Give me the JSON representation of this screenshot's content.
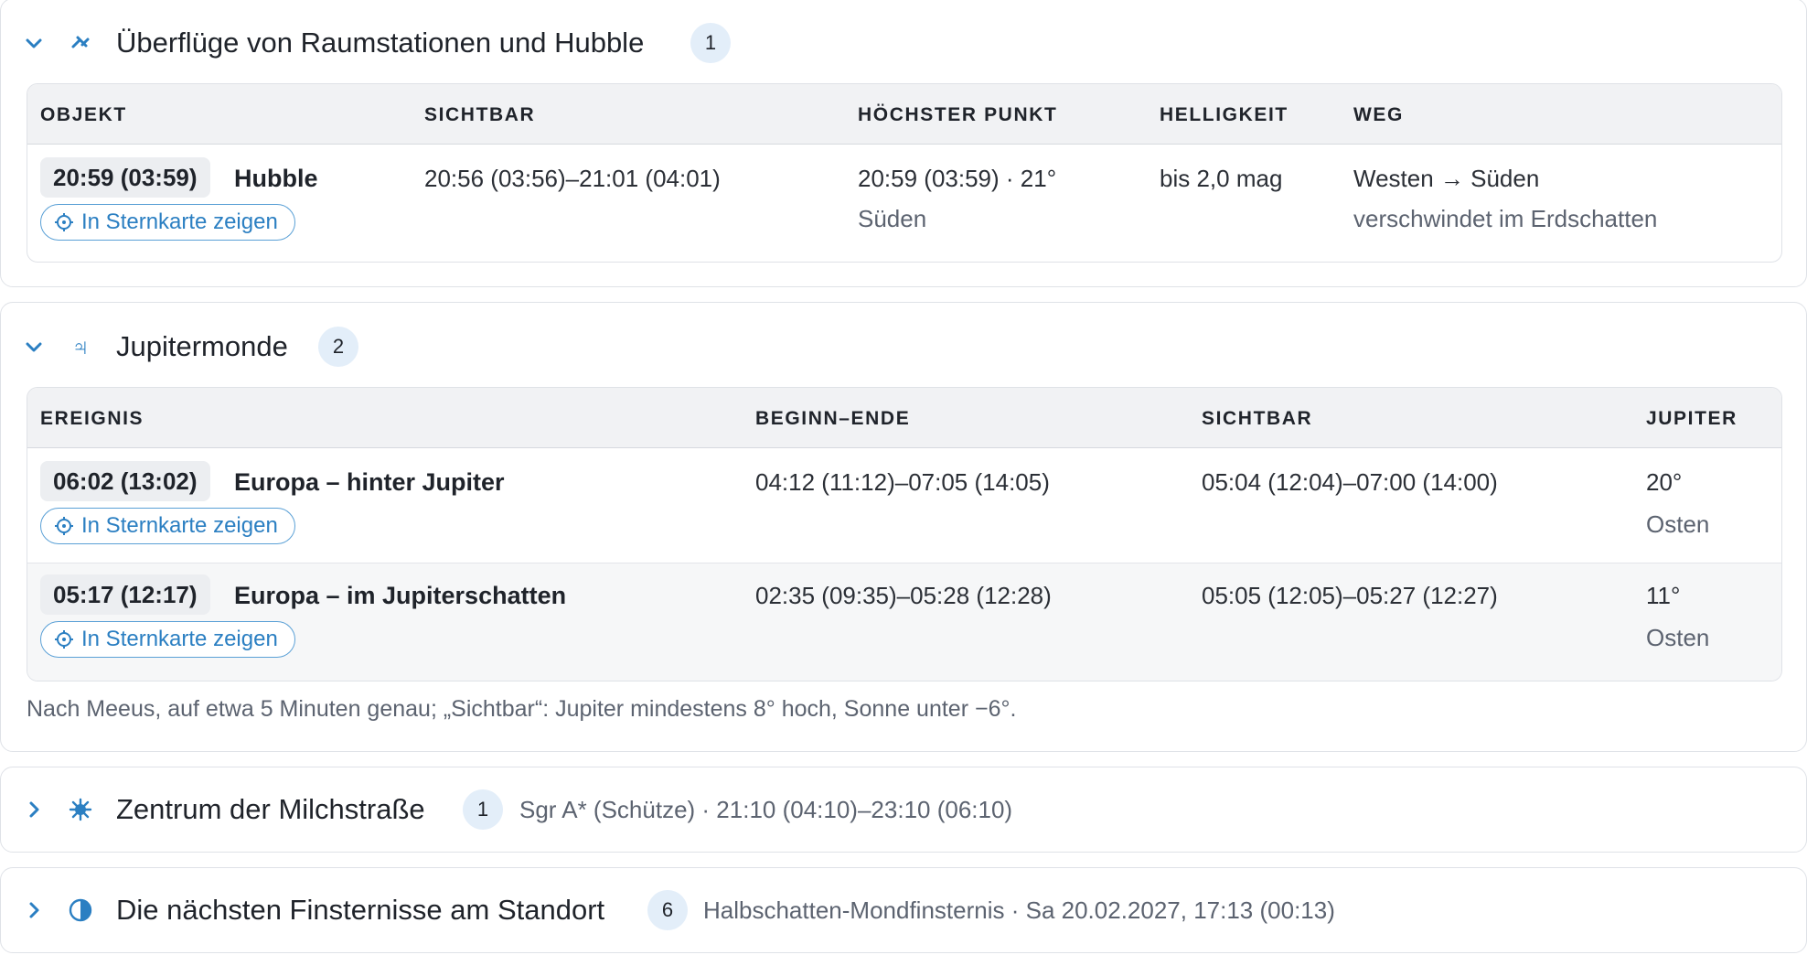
{
  "iss": {
    "title": "Überflüge von Raumstationen und Hubble",
    "count": "1",
    "columns": [
      "OBJEKT",
      "SICHTBAR",
      "HÖCHSTER PUNKT",
      "HELLIGKEIT",
      "WEG"
    ],
    "rows": [
      {
        "time": "20:59 (03:59)",
        "name": "Hubble",
        "map_label": "In Sternkarte zeigen",
        "visible": "20:56 (03:56)–21:01 (04:01)",
        "peak": "20:59 (03:59) · 21°",
        "peak_dir": "Süden",
        "brightness": "bis 2,0 mag",
        "path": "Westen → Süden",
        "path_note": "verschwindet im Erdschatten"
      }
    ]
  },
  "jupiter": {
    "title": "Jupitermonde",
    "count": "2",
    "columns": [
      "EREIGNIS",
      "BEGINN–ENDE",
      "SICHTBAR",
      "JUPITER"
    ],
    "rows": [
      {
        "time": "06:02 (13:02)",
        "name": "Europa – hinter Jupiter",
        "map_label": "In Sternkarte zeigen",
        "range": "04:12 (11:12)–07:05 (14:05)",
        "visible": "05:04 (12:04)–07:00 (14:00)",
        "alt": "20°",
        "dir": "Osten"
      },
      {
        "time": "05:17 (12:17)",
        "name": "Europa – im Jupiterschatten",
        "map_label": "In Sternkarte zeigen",
        "range": "02:35 (09:35)–05:28 (12:28)",
        "visible": "05:05 (12:05)–05:27 (12:27)",
        "alt": "11°",
        "dir": "Osten"
      }
    ],
    "note": "Nach Meeus, auf etwa 5 Minuten genau; „Sichtbar“: Jupiter mindestens 8° hoch, Sonne unter −6°."
  },
  "milkyway": {
    "title": "Zentrum der Milchstraße",
    "count": "1",
    "summary": "Sgr A* (Schütze) · 21:10 (04:10)–23:10 (06:10)"
  },
  "eclipses": {
    "title": "Die nächsten Finsternisse am Standort",
    "count": "6",
    "summary": "Halbschatten-Mondfinsternis · Sa 20.02.2027, 17:13 (00:13)"
  },
  "icons": {
    "expanded": "chevron-down-icon",
    "collapsed": "chevron-right-icon",
    "iss": "satellite-icon",
    "jupiter": "jupiter-symbol-icon",
    "milkyway": "galaxy-burst-icon",
    "eclipse": "half-circle-icon",
    "map": "crosshair-icon"
  },
  "colors": {
    "accent": "#2b7fc2",
    "badge_bg": "#e3eef9"
  }
}
